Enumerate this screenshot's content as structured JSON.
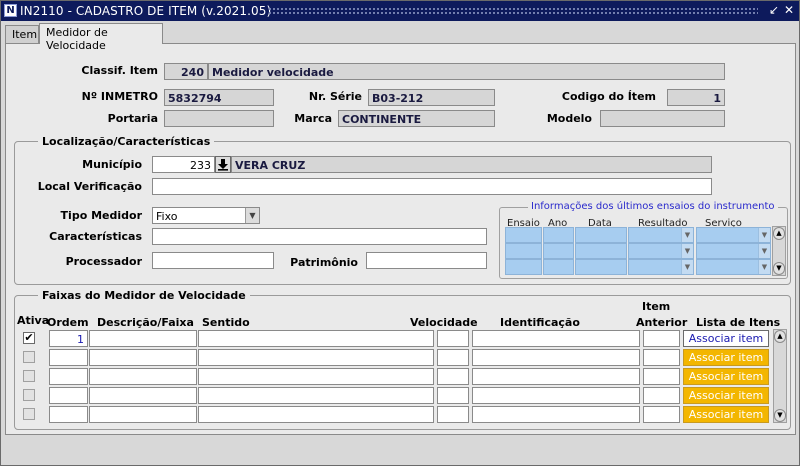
{
  "window": {
    "title": "IN2110 - CADASTRO DE ITEM (v.2021.05)",
    "icon_letter": "N",
    "controls": {
      "minimize": "↙",
      "close": "✕"
    }
  },
  "tabs": [
    {
      "label": "Item",
      "active": false
    },
    {
      "label": "Medidor de Velocidade",
      "active": true
    }
  ],
  "header": {
    "classif_label": "Classif. Item",
    "classif_code": "240",
    "classif_desc": "Medidor velocidade",
    "inmetro_label": "Nº INMETRO",
    "inmetro_value": "5832794",
    "serie_label": "Nr. Série",
    "serie_value": "B03-212",
    "codigo_label": "Codigo do Ítem",
    "codigo_value": "1",
    "portaria_label": "Portaria",
    "portaria_value": "",
    "marca_label": "Marca",
    "marca_value": "CONTINENTE",
    "modelo_label": "Modelo",
    "modelo_value": ""
  },
  "localizacao": {
    "title": "Localização/Características",
    "municipio_label": "Município",
    "municipio_code": "233",
    "municipio_name": "VERA CRUZ",
    "local_label": "Local Verificação",
    "local_value": "",
    "tipo_label": "Tipo Medidor",
    "tipo_value": "Fixo",
    "caracteristicas_label": "Características",
    "caracteristicas_value": "",
    "processador_label": "Processador",
    "processador_value": "",
    "patrimonio_label": "Patrimônio",
    "patrimonio_value": ""
  },
  "ensaios": {
    "title": "Informações dos últimos ensaios do instrumento",
    "columns": [
      "Ensaio",
      "Ano",
      "Data",
      "Resultado",
      "Serviço"
    ],
    "rows": 3
  },
  "faixas": {
    "title": "Faixas do Medidor de Velocidade",
    "col_item_top": "Item",
    "columns": {
      "ativa": "Ativa",
      "ordem": "Ordem",
      "descricao": "Descrição/Faixa",
      "sentido": "Sentido",
      "velocidade": "Velocidade",
      "identificacao": "Identificação",
      "anterior": "Anterior",
      "lista": "Lista de Itens"
    },
    "rows": [
      {
        "ativa": true,
        "ordem": "1",
        "button": "Associar item",
        "enabled": true
      },
      {
        "ativa": false,
        "ordem": "",
        "button": "Associar item",
        "enabled": false
      },
      {
        "ativa": false,
        "ordem": "",
        "button": "Associar item",
        "enabled": false
      },
      {
        "ativa": false,
        "ordem": "",
        "button": "Associar item",
        "enabled": false
      },
      {
        "ativa": false,
        "ordem": "",
        "button": "Associar item",
        "enabled": false
      }
    ]
  },
  "colors": {
    "titlebar": "#0d1a5c",
    "ensaio_cell": "#a7cdf0",
    "button_disabled": "#f3b600"
  }
}
